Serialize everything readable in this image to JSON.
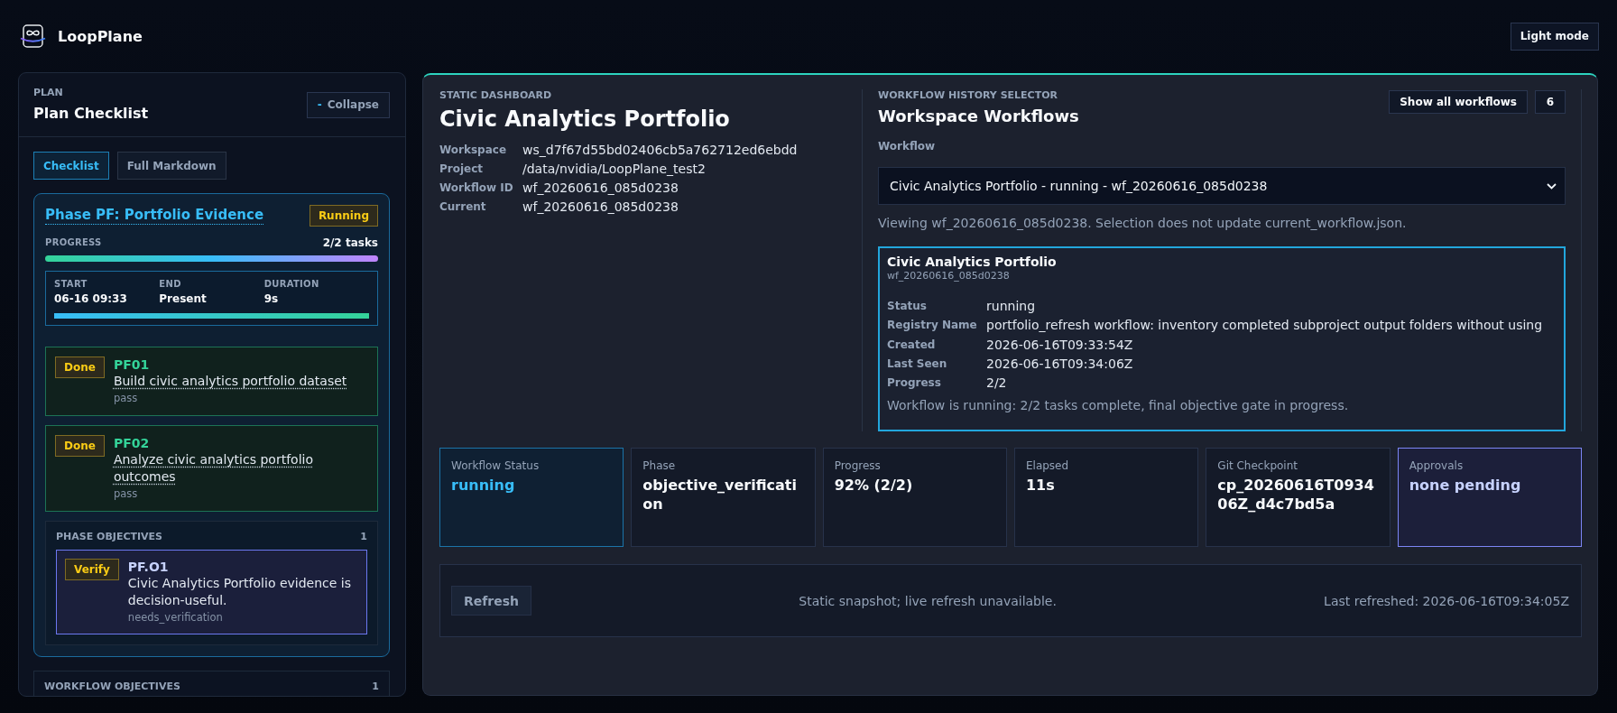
{
  "header": {
    "app_name": "LoopPlane",
    "theme_button": "Light mode"
  },
  "plan": {
    "eyebrow": "PLAN",
    "title": "Plan Checklist",
    "collapse_button": {
      "glyph": "-",
      "label": "Collapse"
    },
    "tabs": [
      {
        "label": "Checklist",
        "selected": true
      },
      {
        "label": "Full Markdown",
        "selected": false
      }
    ],
    "phase": {
      "title": "Phase PF: Portfolio Evidence",
      "badge": "Running",
      "progress_label": "PROGRESS",
      "progress_count": "2/2 tasks",
      "level": 1,
      "timing": {
        "fields": [
          {
            "label": "START",
            "value": "06-16 09:33"
          },
          {
            "label": "END",
            "value": "Present"
          },
          {
            "label": "DURATION",
            "value": "9s"
          }
        ],
        "level": 1
      },
      "tasks": [
        {
          "kind": "done",
          "badge": "Done",
          "id": "PF01",
          "title": "Build civic analytics portfolio dataset",
          "result": "pass"
        },
        {
          "kind": "done",
          "badge": "Done",
          "id": "PF02",
          "title": "Analyze civic analytics portfolio outcomes",
          "result": "pass"
        }
      ],
      "objectives": {
        "heading": "PHASE OBJECTIVES",
        "count": "1",
        "items": [
          {
            "kind": "verify",
            "badge": "Verify",
            "id": "PF.O1",
            "text": "Civic Analytics Portfolio evidence is decision-useful.",
            "result": "needs_verification"
          }
        ]
      }
    },
    "workflow_objectives": {
      "heading": "WORKFLOW OBJECTIVES",
      "count": "1"
    }
  },
  "dashboard": {
    "eyebrow": "STATIC DASHBOARD",
    "title": "Civic Analytics Portfolio",
    "fields": [
      {
        "label": "Workspace",
        "value": "ws_d7f67d55bd02406cb5a762712ed6ebdd"
      },
      {
        "label": "Project",
        "value": "/data/nvidia/LoopPlane_test2"
      },
      {
        "label": "Workflow ID",
        "value": "wf_20260616_085d0238"
      },
      {
        "label": "Current",
        "value": "wf_20260616_085d0238"
      }
    ]
  },
  "history": {
    "eyebrow": "WORKFLOW HISTORY SELECTOR",
    "title": "Workspace Workflows",
    "show_all_button": "Show all workflows",
    "workflow_count": "6",
    "select_label": "Workflow",
    "select_value": "Civic Analytics Portfolio - running - wf_20260616_085d0238",
    "note": "Viewing wf_20260616_085d0238. Selection does not update current_workflow.json.",
    "detail": {
      "name": "Civic Analytics Portfolio",
      "id": "wf_20260616_085d0238",
      "fields": [
        {
          "label": "Status",
          "value": "running"
        },
        {
          "label": "Registry Name",
          "value": "portfolio_refresh workflow: inventory completed subproject output folders without using"
        },
        {
          "label": "Created",
          "value": "2026-06-16T09:33:54Z"
        },
        {
          "label": "Last Seen",
          "value": "2026-06-16T09:34:06Z"
        },
        {
          "label": "Progress",
          "value": "2/2"
        }
      ],
      "summary": "Workflow is running: 2/2 tasks complete, final objective gate in progress."
    }
  },
  "stats": [
    {
      "kind": "highlight",
      "label": "Workflow Status",
      "value": "running"
    },
    {
      "kind": "plain",
      "label": "Phase",
      "value": "objective_verification"
    },
    {
      "kind": "plain",
      "label": "Progress",
      "value": "92% (2/2)"
    },
    {
      "kind": "plain",
      "label": "Elapsed",
      "value": "11s"
    },
    {
      "kind": "plain",
      "label": "Git Checkpoint",
      "value": "cp_20260616T093406Z_d4c7bd5a"
    },
    {
      "kind": "accent",
      "label": "Approvals",
      "value": "none pending"
    }
  ],
  "refresh": {
    "button": "Refresh",
    "message": "Static snapshot; live refresh unavailable.",
    "last_refreshed": "Last refreshed: 2026-06-16T09:34:05Z"
  }
}
